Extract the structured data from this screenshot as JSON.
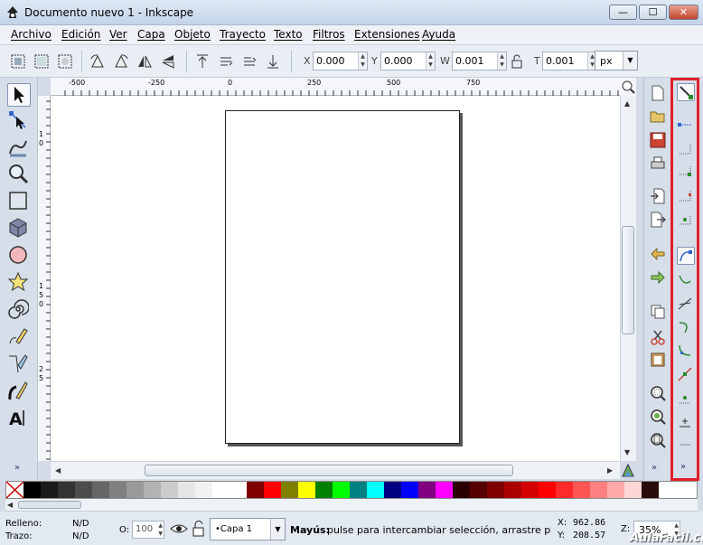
{
  "window": {
    "title": "Documento nuevo 1 - Inkscape",
    "min": "▭",
    "max": "▢",
    "close": "✕"
  },
  "menu": [
    "Archivo",
    "Edición",
    "Ver",
    "Capa",
    "Objeto",
    "Trayecto",
    "Texto",
    "Filtros",
    "Extensiones",
    "Ayuda"
  ],
  "toolbar": {
    "x_label": "X",
    "x_value": "0.000",
    "y_label": "Y",
    "y_value": "0.000",
    "w_label": "W",
    "w_value": "0.001",
    "h_label": "T",
    "h_value": "0.001",
    "unit": "px"
  },
  "ruler": {
    "h_ticks": [
      "-500",
      "-250",
      "0",
      "250",
      "500",
      "750"
    ],
    "v_ticks": [
      "1",
      "0",
      "1",
      "5",
      "0",
      "2",
      "5"
    ]
  },
  "more_label": "»",
  "status": {
    "fill_label": "Relleno:",
    "fill_value": "N/D",
    "stroke_label": "Trazo:",
    "stroke_value": "N/D",
    "opacity_label": "O:",
    "opacity_value": "100",
    "layer": "•Capa 1",
    "message_bold": "Mayús:",
    "message": "pulse para intercambiar selección, arrastre para",
    "x_label": "X:",
    "x_value": "962.86",
    "y_label": "Y:",
    "y_value": "208.57",
    "zoom_label": "Z:",
    "zoom_value": "35%"
  },
  "watermark": "AulaFacil.com",
  "palette": [
    "#000000",
    "#1a1a1a",
    "#333333",
    "#4d4d4d",
    "#666666",
    "#808080",
    "#999999",
    "#b3b3b3",
    "#cccccc",
    "#e6e6e6",
    "#f2f2f2",
    "#ffffff",
    "#ffffff",
    "#800000",
    "#ff0000",
    "#808000",
    "#ffff00",
    "#008000",
    "#00ff00",
    "#008080",
    "#00ffff",
    "#000080",
    "#0000ff",
    "#800080",
    "#ff00ff",
    "#2b0000",
    "#550000",
    "#800000",
    "#aa0000",
    "#d40000",
    "#ff0000",
    "#ff2a2a",
    "#ff5555",
    "#ff8080",
    "#ffaaaa",
    "#ffd5d5",
    "#280b0b"
  ]
}
